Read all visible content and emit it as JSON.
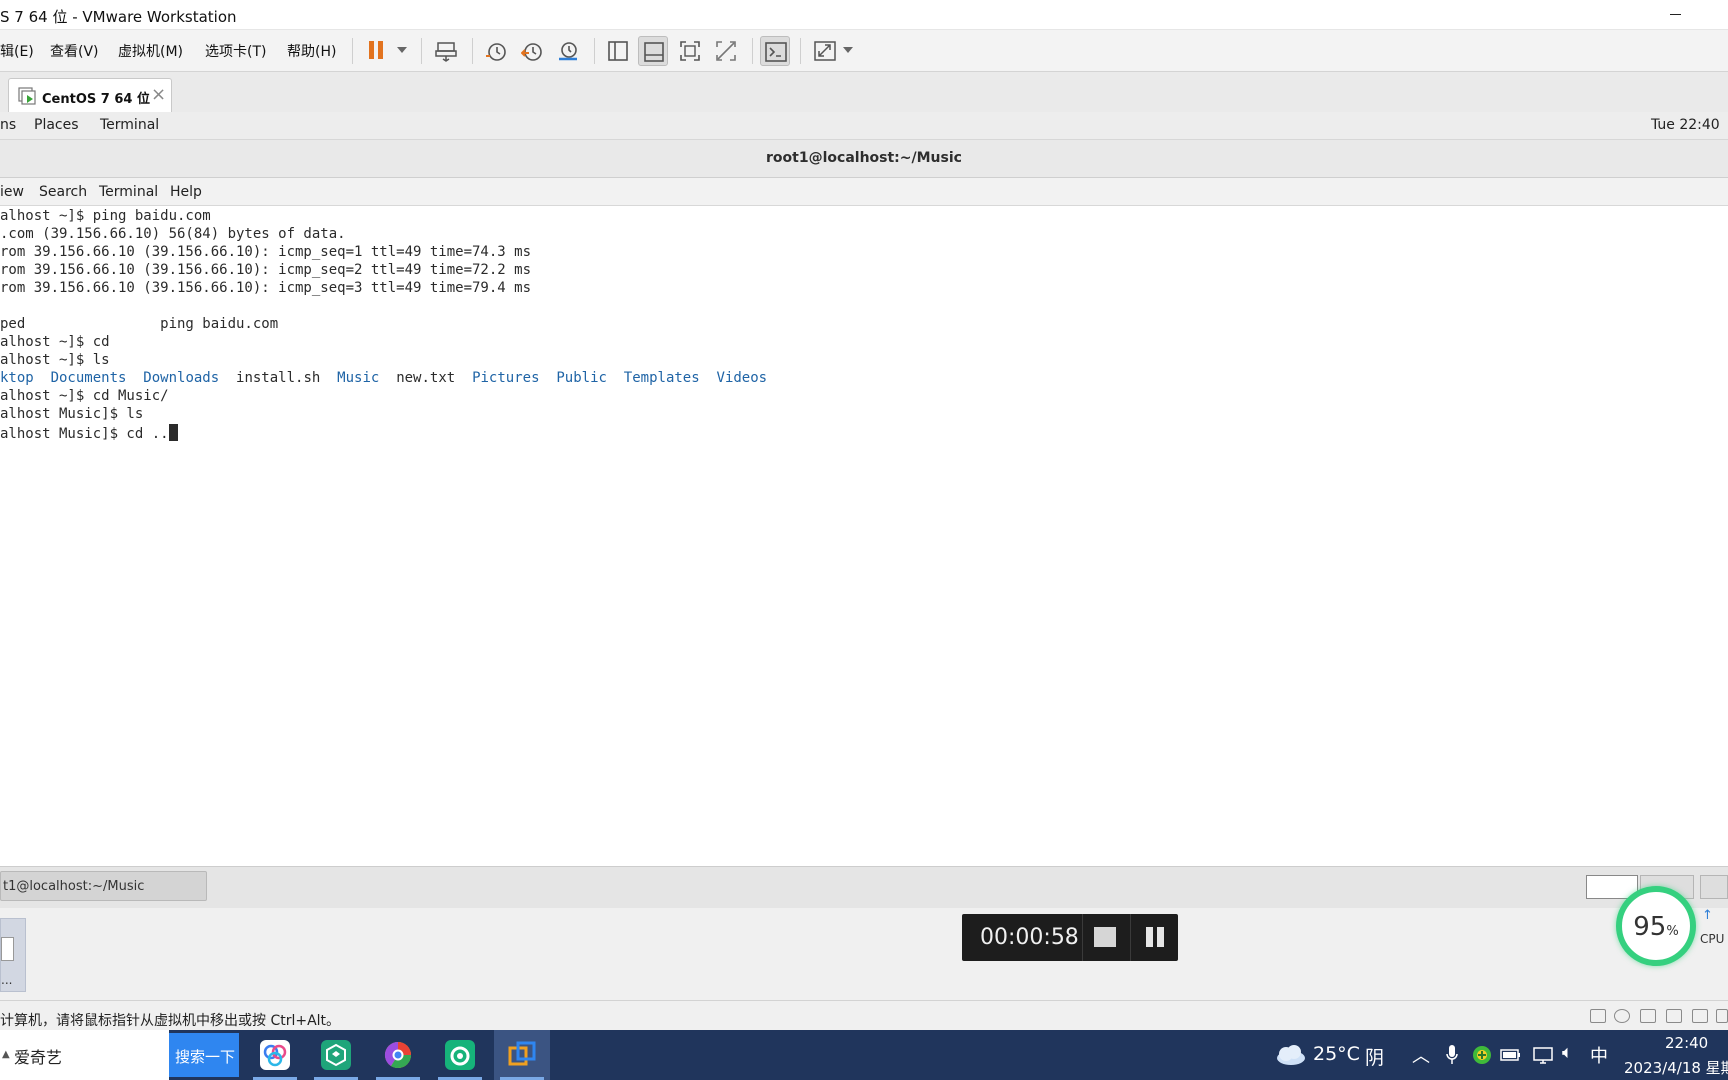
{
  "window": {
    "title": "S 7 64 位 - VMware Workstation"
  },
  "vm_menu": {
    "items": [
      "辑(E)",
      "查看(V)",
      "虚拟机(M)",
      "选项卡(T)",
      "帮助(H)"
    ]
  },
  "vm_tab": {
    "label": "CentOS 7 64 位"
  },
  "gnome_topbar": {
    "applications_partial": "ns",
    "places": "Places",
    "terminal": "Terminal",
    "clock": "Tue 22:40"
  },
  "terminal_window": {
    "title": "root1@localhost:~/Music",
    "menu": [
      "iew",
      "Search",
      "Terminal",
      "Help"
    ]
  },
  "terminal_lines": [
    "alhost ~]$ ping baidu.com",
    ".com (39.156.66.10) 56(84) bytes of data.",
    "rom 39.156.66.10 (39.156.66.10): icmp_seq=1 ttl=49 time=74.3 ms",
    "rom 39.156.66.10 (39.156.66.10): icmp_seq=2 ttl=49 time=72.2 ms",
    "rom 39.156.66.10 (39.156.66.10): icmp_seq=3 ttl=49 time=79.4 ms",
    "",
    "ped                ping baidu.com",
    "alhost ~]$ cd",
    "alhost ~]$ ls"
  ],
  "ls_output": {
    "entries": [
      {
        "name": "ktop",
        "type": "dir"
      },
      {
        "name": "Documents",
        "type": "dir"
      },
      {
        "name": "Downloads",
        "type": "dir"
      },
      {
        "name": "install.sh",
        "type": "file"
      },
      {
        "name": "Music",
        "type": "dir"
      },
      {
        "name": "new.txt",
        "type": "file"
      },
      {
        "name": "Pictures",
        "type": "dir"
      },
      {
        "name": "Public",
        "type": "dir"
      },
      {
        "name": "Templates",
        "type": "dir"
      },
      {
        "name": "Videos",
        "type": "dir"
      }
    ]
  },
  "terminal_lines_after": [
    "alhost ~]$ cd Music/",
    "alhost Music]$ ls",
    "alhost Music]$ cd .."
  ],
  "gnome_bottom": {
    "task_label": "t1@localhost:~/Music"
  },
  "thumbnail": {
    "label": "..."
  },
  "recorder": {
    "elapsed": "00:00:58"
  },
  "cpu_widget": {
    "percent": "95",
    "unit": "%",
    "label": "CPU",
    "arrow": "↑"
  },
  "status_bar": {
    "message": "计算机，请将鼠标指针从虚拟机中移出或按 Ctrl+Alt。"
  },
  "taskbar": {
    "search_text": "爱奇艺",
    "search_button": "搜索一下",
    "weather_temp": "25°C",
    "weather_cond": "阴",
    "ime": "中",
    "time": "22:40",
    "date": "2023/4/18 星期"
  },
  "colors": {
    "taskbar_bg": "#20355c",
    "dir_blue": "#1f64a6",
    "cpu_green": "#35d07f",
    "search_btn": "#2f86f0"
  }
}
